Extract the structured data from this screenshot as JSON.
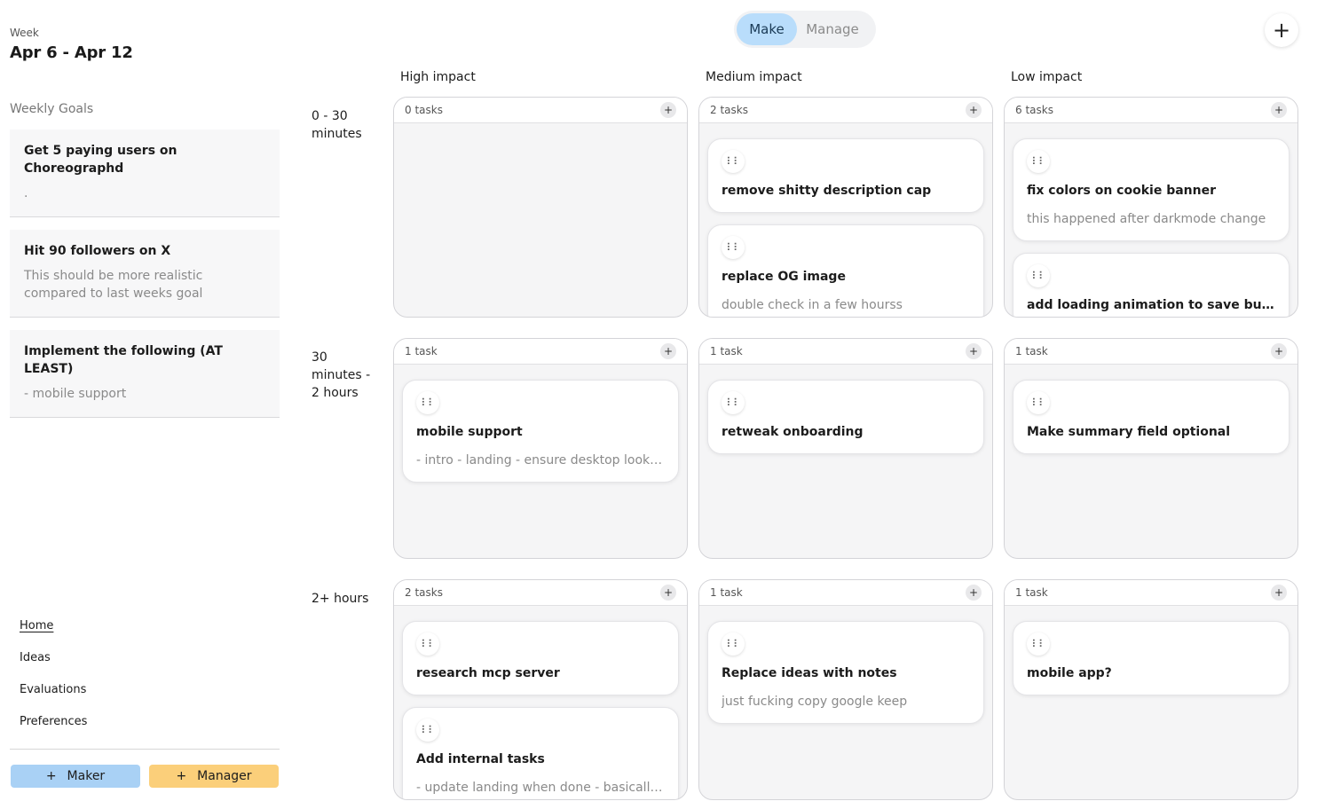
{
  "header": {
    "week_label": "Week",
    "week_range": "Apr 6 - Apr 12",
    "mode_toggle": {
      "make": "Make",
      "manage": "Manage",
      "active": "Make"
    },
    "add_icon": "+"
  },
  "sidebar": {
    "goals_title": "Weekly Goals",
    "goals": [
      {
        "title": "Get 5 paying users on Choreographd",
        "description": "."
      },
      {
        "title": "Hit 90 followers on X",
        "description": "This should be more realistic compared to last weeks goal"
      },
      {
        "title": "Implement the following (AT LEAST)",
        "description": "- mobile support"
      }
    ],
    "nav": [
      {
        "label": "Home",
        "active": true
      },
      {
        "label": "Ideas"
      },
      {
        "label": "Evaluations"
      },
      {
        "label": "Preferences"
      }
    ],
    "buttons": {
      "maker": "Maker",
      "manager": "Manager",
      "plus": "+"
    }
  },
  "colors": {
    "accent_blue": "#b9ddfb",
    "maker_btn": "#a9d1f5",
    "manager_btn": "#fbcf7a"
  },
  "matrix": {
    "columns": [
      "High impact",
      "Medium impact",
      "Low impact"
    ],
    "rows": [
      "0 - 30 minutes",
      "30 minutes - 2 hours",
      "2+ hours"
    ],
    "cells": [
      [
        {
          "count": "0 tasks",
          "tasks": []
        },
        {
          "count": "2 tasks",
          "tasks": [
            {
              "title": "remove shitty description cap",
              "description": ""
            },
            {
              "title": "replace OG image",
              "description": "double check in a few hourss"
            }
          ]
        },
        {
          "count": "6 tasks",
          "tasks": [
            {
              "title": "fix colors on cookie banner",
              "description": "this happened after darkmode change"
            },
            {
              "title": "add loading animation to save button",
              "description": ""
            }
          ]
        }
      ],
      [
        {
          "count": "1 task",
          "tasks": [
            {
              "title": "mobile support",
              "description": "- intro - landing - ensure desktop looks fi..."
            }
          ]
        },
        {
          "count": "1 task",
          "tasks": [
            {
              "title": "retweak onboarding",
              "description": ""
            }
          ]
        },
        {
          "count": "1 task",
          "tasks": [
            {
              "title": "Make summary field optional",
              "description": ""
            }
          ]
        }
      ],
      [
        {
          "count": "2 tasks",
          "tasks": [
            {
              "title": "research mcp server",
              "description": ""
            },
            {
              "title": "Add internal tasks",
              "description": "- update landing when done - basically ta..."
            }
          ]
        },
        {
          "count": "1 task",
          "tasks": [
            {
              "title": "Replace ideas with notes",
              "description": "just fucking copy google keep"
            }
          ]
        },
        {
          "count": "1 task",
          "tasks": [
            {
              "title": "mobile app?",
              "description": ""
            }
          ]
        }
      ]
    ]
  }
}
